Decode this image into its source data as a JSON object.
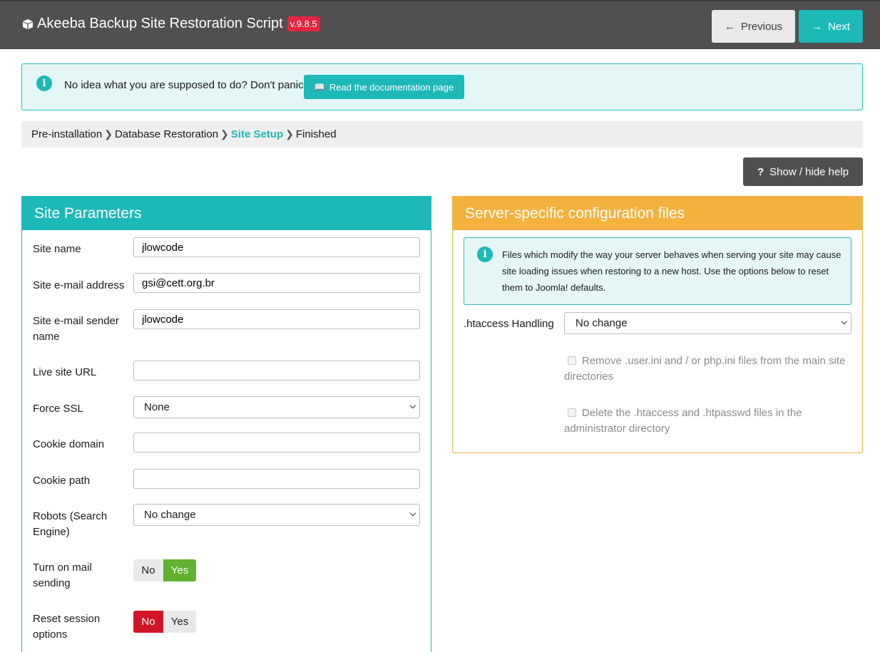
{
  "header": {
    "title": "Akeeba Backup Site Restoration Script",
    "version": "v.9.8.5",
    "prev_label": "Previous",
    "next_label": "Next"
  },
  "alert": {
    "message": "No idea what you are supposed to do? Don't panic!",
    "doc_button": "Read the documentation page"
  },
  "breadcrumb": {
    "steps": [
      "Pre-installation",
      "Database Restoration",
      "Site Setup",
      "Finished"
    ],
    "active": "Site Setup"
  },
  "help_button": "Show / hide help",
  "site_params": {
    "title": "Site Parameters",
    "site_name": {
      "label": "Site name",
      "value": "jlowcode"
    },
    "site_email": {
      "label": "Site e-mail address",
      "value": "gsi@cett.org.br"
    },
    "sender_name": {
      "label": "Site e-mail sender name",
      "value": "jlowcode"
    },
    "live_url": {
      "label": "Live site URL",
      "value": ""
    },
    "force_ssl": {
      "label": "Force SSL",
      "value": "None"
    },
    "cookie_domain": {
      "label": "Cookie domain",
      "value": ""
    },
    "cookie_path": {
      "label": "Cookie path",
      "value": ""
    },
    "robots": {
      "label": "Robots (Search Engine)",
      "value": "No change"
    },
    "mail_sending": {
      "label": "Turn on mail sending",
      "no": "No",
      "yes": "Yes",
      "selected": "Yes"
    },
    "reset_session": {
      "label": "Reset session options",
      "no": "No",
      "yes": "Yes",
      "selected": "No"
    }
  },
  "server_config": {
    "title": "Server-specific configuration files",
    "info": "Files which modify the way your server behaves when serving your site may cause site loading issues when restoring to a new host. Use the options below to reset them to Joomla! defaults.",
    "htaccess_label": ".htaccess Handling",
    "htaccess_value": "No change",
    "remove_user_ini": "Remove .user.ini and / or php.ini files from the main site directories",
    "delete_htaccess": "Delete the .htaccess and .htpasswd files in the administrator directory"
  }
}
